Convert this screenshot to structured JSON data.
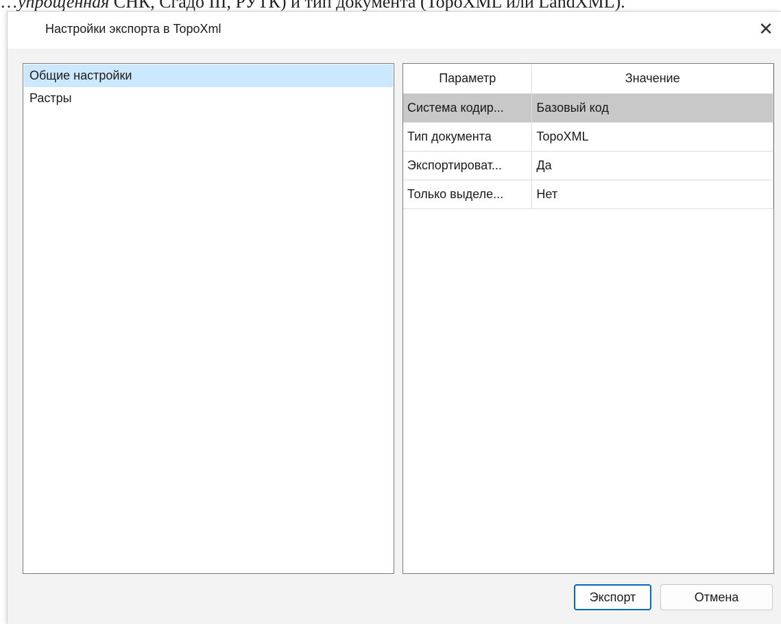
{
  "background_doc": {
    "prefix": "…",
    "italic_fragment": "упрощенная",
    "rest": " СНК, Сгадо III, РУТК) и тип документа (TopoXML или LandXML)."
  },
  "dialog": {
    "title": "Настройки экспорта в TopoXml",
    "close_glyph": "✕"
  },
  "left_panel": {
    "items": [
      {
        "label": "Общие настройки",
        "selected": true
      },
      {
        "label": "Растры",
        "selected": false
      }
    ]
  },
  "grid": {
    "headers": [
      "Параметр",
      "Значение"
    ],
    "rows": [
      {
        "param": "Система кодир...",
        "value": "Базовый код"
      },
      {
        "param": "Тип документа",
        "value": "TopoXML"
      },
      {
        "param": "Экспортироват...",
        "value": "Да"
      },
      {
        "param": "Только выделе...",
        "value": "Нет"
      }
    ]
  },
  "buttons": {
    "export": "Экспорт",
    "cancel": "Отмена"
  },
  "colors": {
    "accent": "#0067c0",
    "tree_selection": "#cce8ff",
    "row_selection": "#c8c8c8"
  }
}
